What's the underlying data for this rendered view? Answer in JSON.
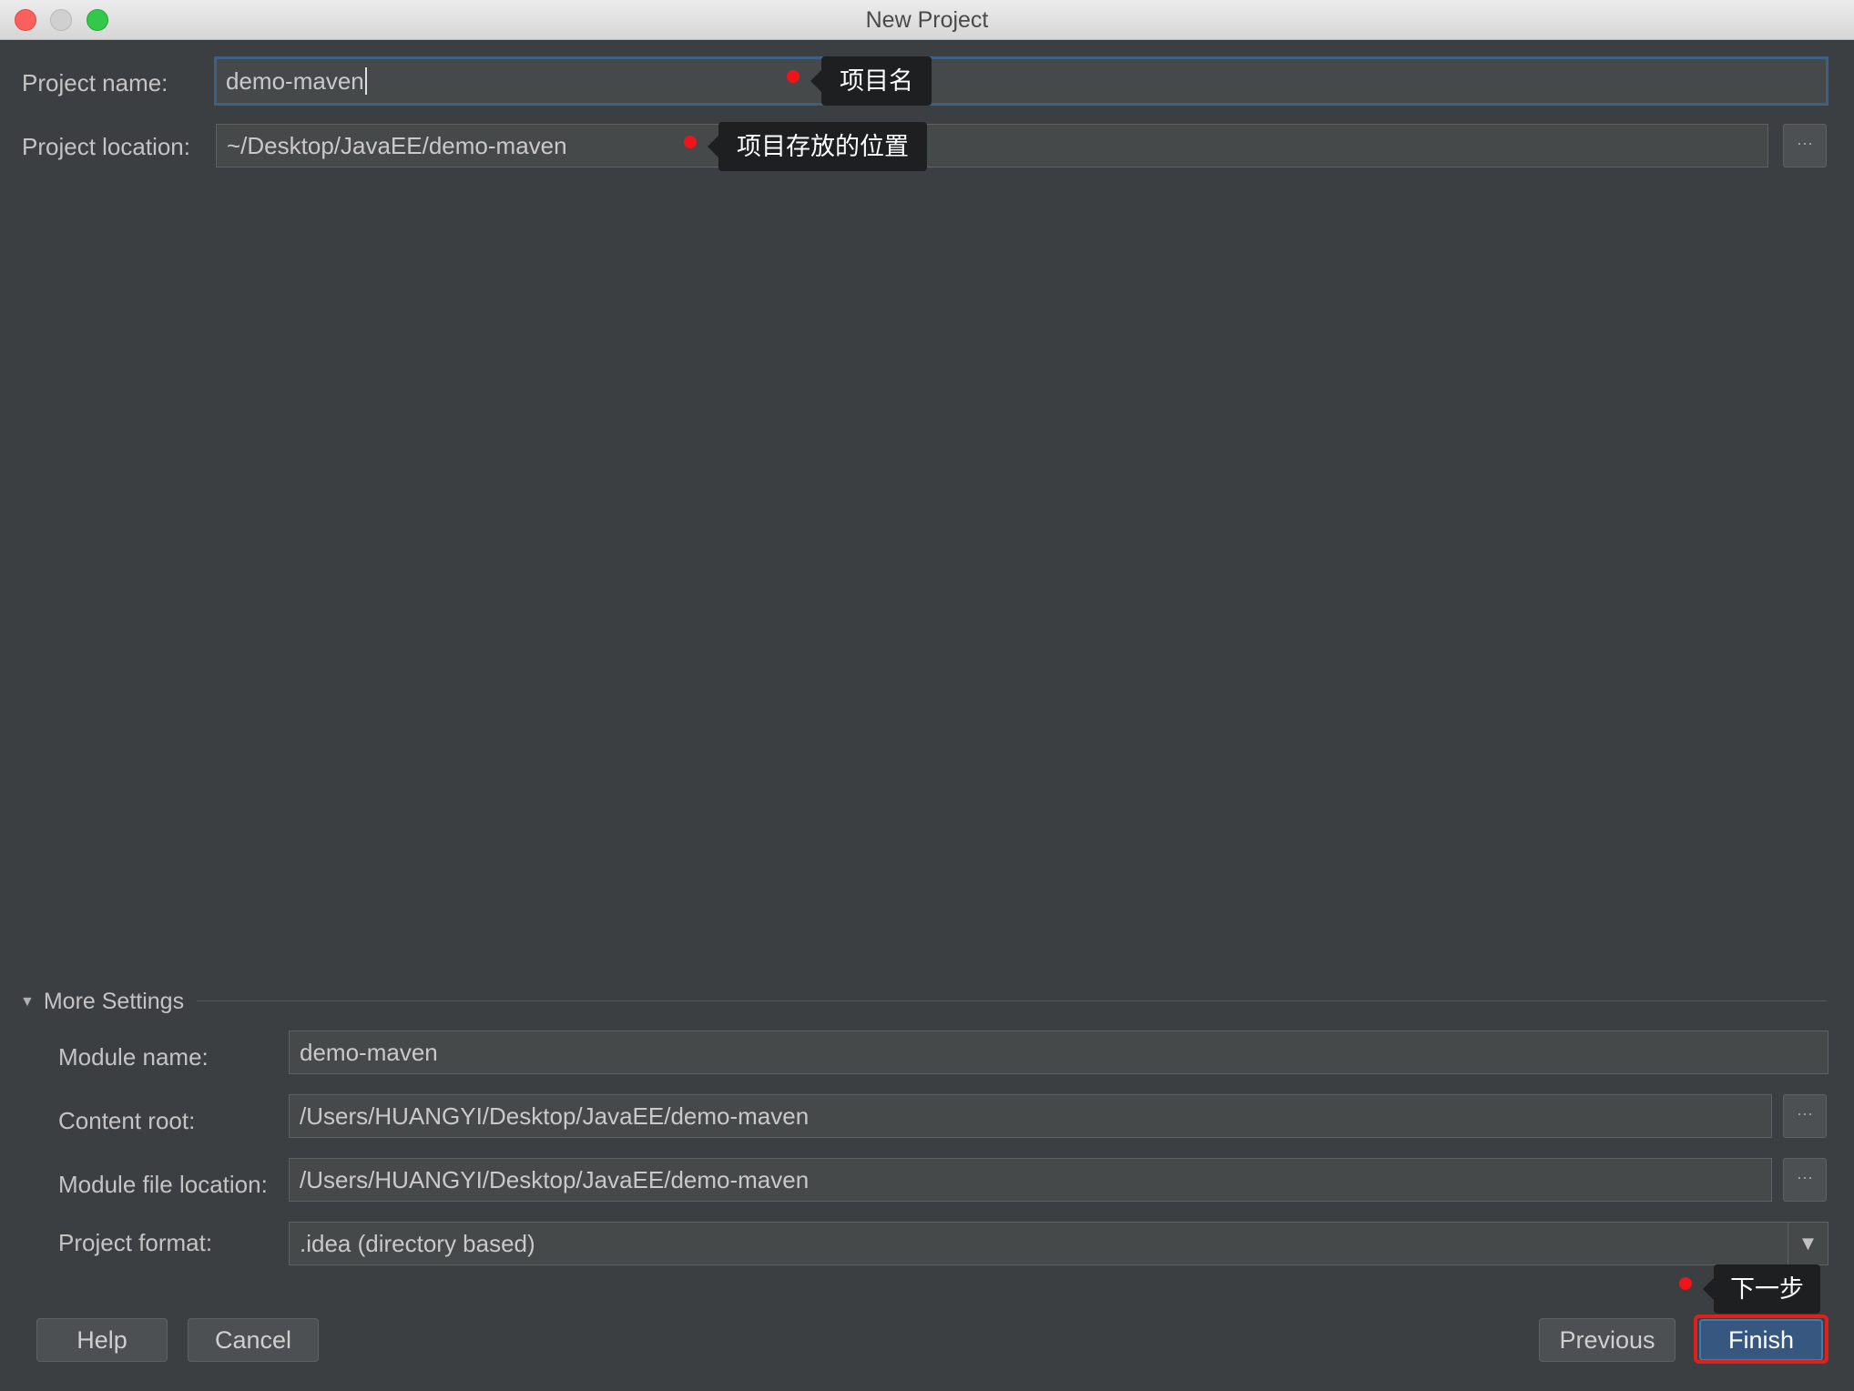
{
  "window": {
    "title": "New Project"
  },
  "project_name": {
    "label": "Project name:",
    "value": "demo-maven",
    "annotation": "项目名"
  },
  "project_location": {
    "label": "Project location:",
    "value": "~/Desktop/JavaEE/demo-maven",
    "annotation": "项目存放的位置",
    "browse_label": "···"
  },
  "more_settings": {
    "label": "More Settings",
    "expanded": true,
    "module_name": {
      "label": "Module name:",
      "value": "demo-maven"
    },
    "content_root": {
      "label": "Content root:",
      "value": "/Users/HUANGYI/Desktop/JavaEE/demo-maven",
      "browse_label": "···"
    },
    "module_file_location": {
      "label": "Module file location:",
      "value": "/Users/HUANGYI/Desktop/JavaEE/demo-maven",
      "browse_label": "···"
    },
    "project_format": {
      "label": "Project format:",
      "value": ".idea (directory based)"
    }
  },
  "footer": {
    "help_label": "Help",
    "cancel_label": "Cancel",
    "previous_label": "Previous",
    "finish_label": "Finish",
    "finish_annotation": "下一步"
  },
  "colors": {
    "background": "#3c3f41",
    "field": "#45494a",
    "focus_border": "#3d6185",
    "primary_button": "#365880",
    "annotation_dot": "#f0141a",
    "annotation_tip": "#1e1f20"
  }
}
